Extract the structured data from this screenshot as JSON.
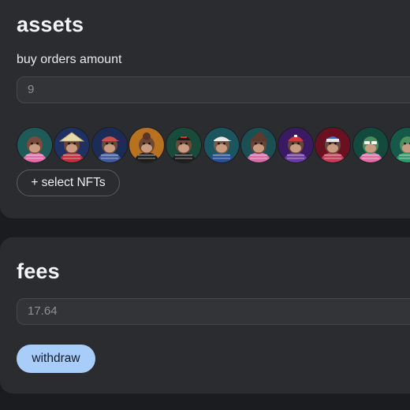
{
  "assets": {
    "title": "assets",
    "buy_orders_label": "buy orders amount",
    "buy_orders_value": "9",
    "select_button_label": "+ select NFTs",
    "nfts": [
      {
        "icon": "ape-nft-icon",
        "bg": "#1e5a58",
        "hat": "none",
        "shirt": "#e26aa8",
        "fur": "#7a4b3a"
      },
      {
        "icon": "ape-nft-icon",
        "bg": "#1f3163",
        "hat": "conical",
        "shirt": "#c22f3c",
        "fur": "#6b4436"
      },
      {
        "icon": "ape-nft-icon",
        "bg": "#1c2c57",
        "hat": "cap-red",
        "shirt": "#3f5a9e",
        "fur": "#6a4a3b"
      },
      {
        "icon": "ape-nft-icon",
        "bg": "#b8711f",
        "hat": "bun",
        "shirt": "#1c1c1c",
        "fur": "#6d4634"
      },
      {
        "icon": "ape-nft-icon",
        "bg": "#1a4a3a",
        "hat": "beanie-black",
        "shirt": "#1e1e1e",
        "fur": "#6b4a3a"
      },
      {
        "icon": "ape-nft-icon",
        "bg": "#1a5560",
        "hat": "cap-white",
        "shirt": "#2a4f9a",
        "fur": "#775a46"
      },
      {
        "icon": "ape-nft-icon",
        "bg": "#1c4f53",
        "hat": "witch",
        "shirt": "#d86aa6",
        "fur": "#6a4535"
      },
      {
        "icon": "ape-nft-icon",
        "bg": "#3a1a63",
        "hat": "helmet-red",
        "shirt": "#6a3aa2",
        "fur": "#664637"
      },
      {
        "icon": "ape-nft-icon",
        "bg": "#6a1020",
        "hat": "helmet-blue",
        "shirt": "#c63b57",
        "fur": "#6a4a3b"
      },
      {
        "icon": "ape-nft-icon",
        "bg": "#124a3e",
        "hat": "glasses",
        "shirt": "#e06ca3",
        "fur": "#4e8a5e"
      },
      {
        "icon": "ape-nft-icon",
        "bg": "#155a48",
        "hat": "none",
        "shirt": "#2f9a6a",
        "fur": "#4f8f60"
      }
    ]
  },
  "fees": {
    "title": "fees",
    "value": "17.64",
    "withdraw_label": "withdraw"
  }
}
